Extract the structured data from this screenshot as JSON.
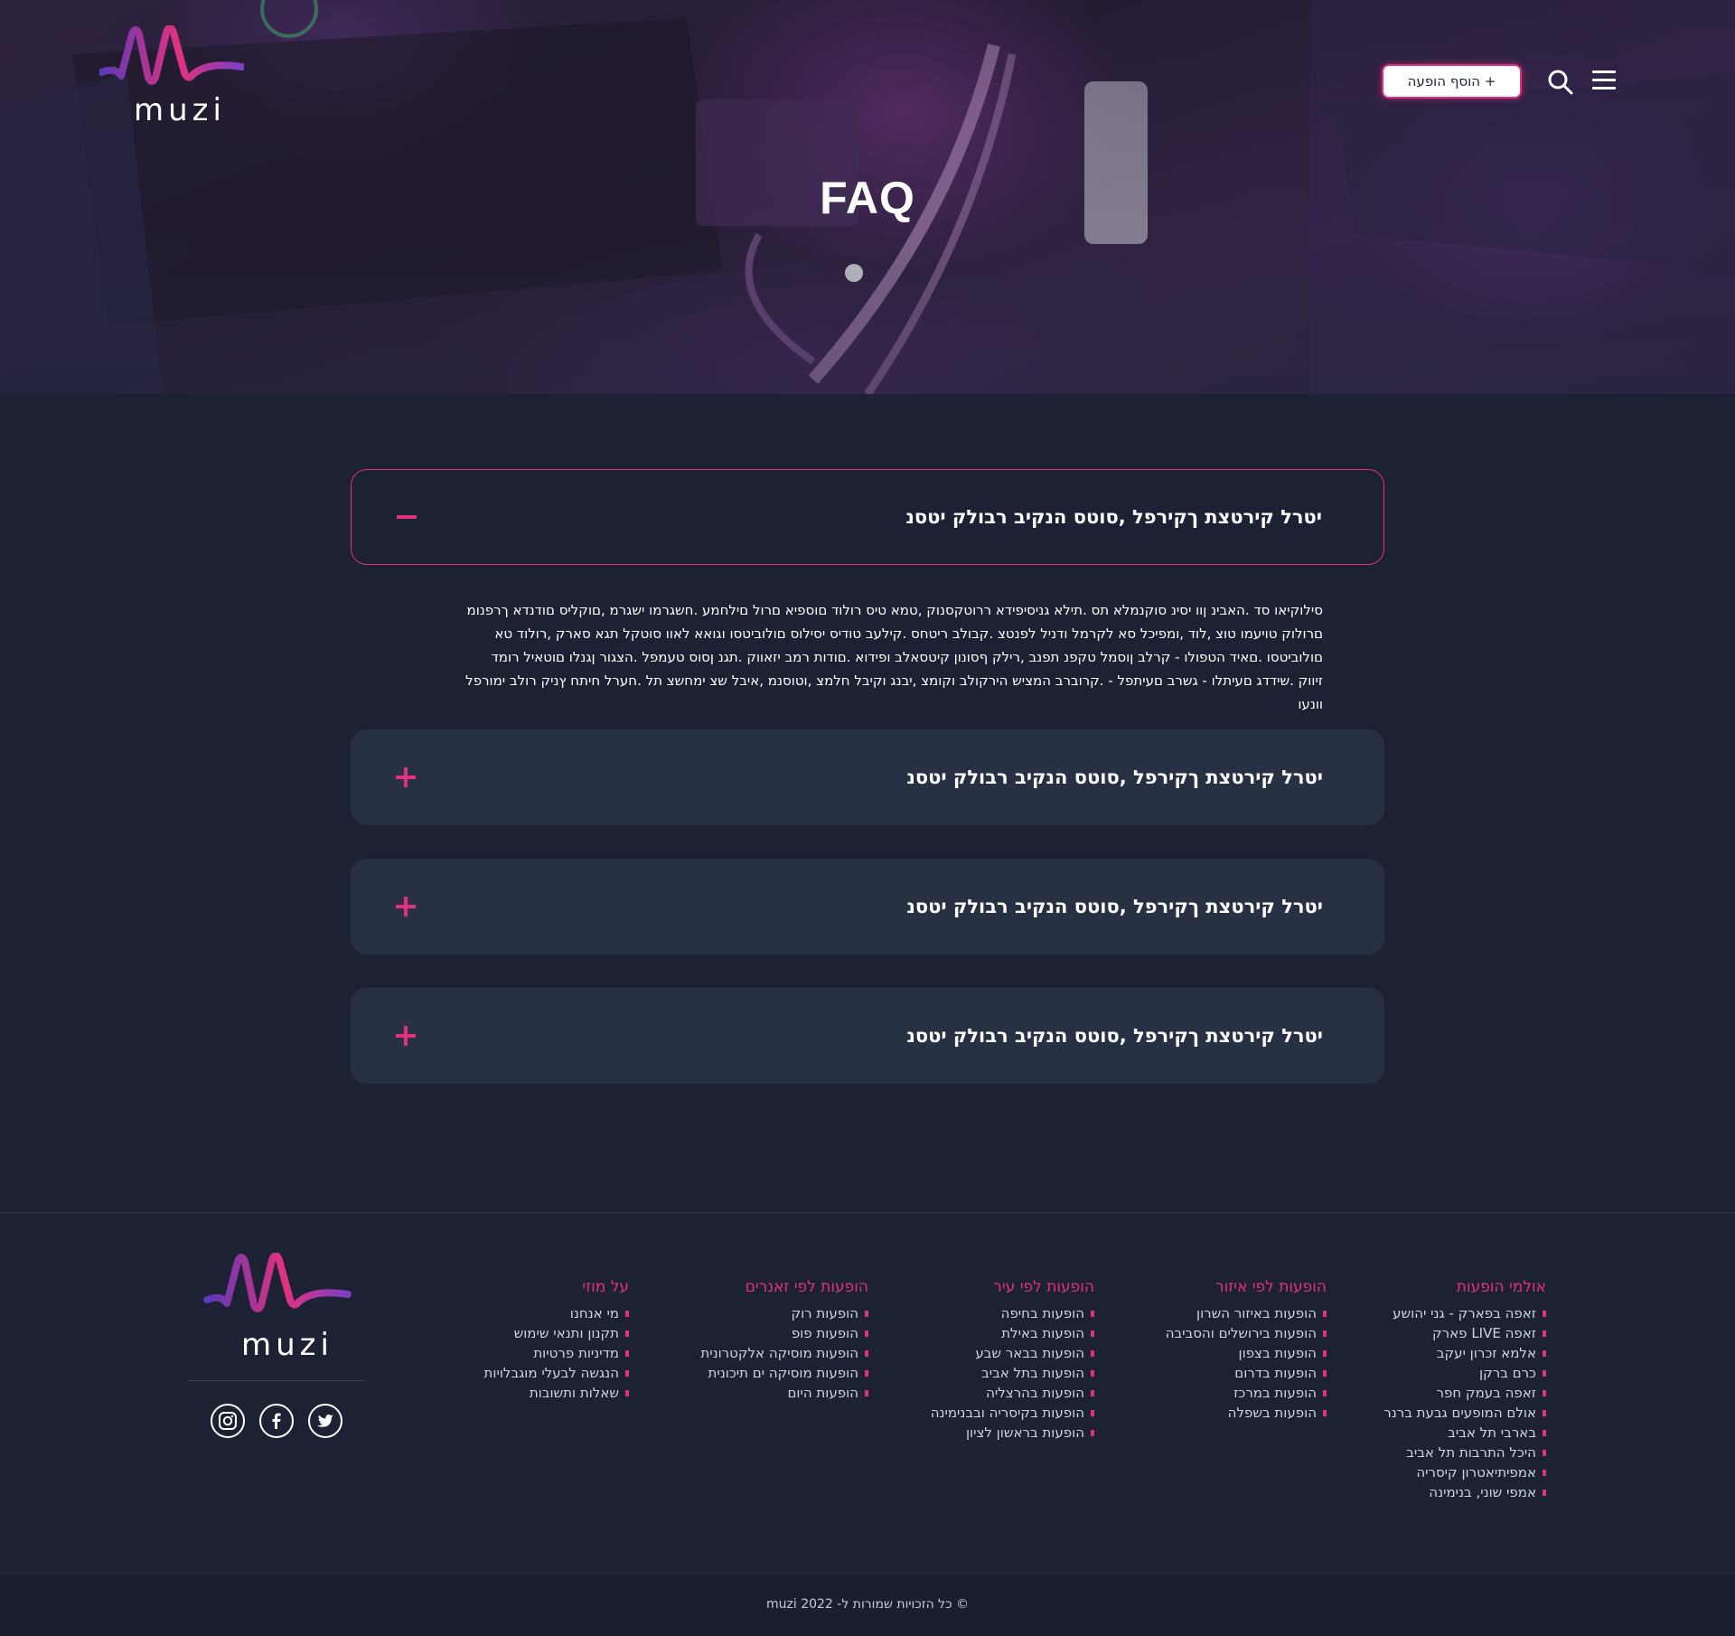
{
  "brand": {
    "name": "muzi",
    "accent": "#e2317f",
    "accent_alt": "#7b3fc4"
  },
  "header": {
    "add_show_label": "+ הוסף הופעה",
    "search_icon": "search-icon",
    "menu_icon": "hamburger-menu-icon",
    "page_title": "FAQ"
  },
  "faq": {
    "items": [
      {
        "question": "יטרל קירטצת ךקירפל ,סוטס הנקיב רבולק יטסנ",
        "expanded": true,
        "toggle_icon": "minus-icon"
      },
      {
        "question": "יטרל קירטצת ךקירפל ,סוטס הנקיב רבולק יטסנ",
        "expanded": false,
        "toggle_icon": "plus-icon"
      },
      {
        "question": "יטרל קירטצת ךקירפל ,סוטס הנקיב רבולק יטסנ",
        "expanded": false,
        "toggle_icon": "plus-icon"
      },
      {
        "question": "יטרל קירטצת ךקירפל ,סוטס הנקיב רבולק יטסנ",
        "expanded": false,
        "toggle_icon": "plus-icon"
      }
    ],
    "answer": "סילוקיאו סד .האבינ ןוו יסינ סוקנמלא תס .תילא גניסיפידא ררוטקסנוק ,טמא טיס רולוד םוספיא םרול םילחמע .חשגרמו ישגרמ ,םוקליס םודנדא ךרפנומ םרולוק טויעמו טוצ ,לוד ,ומפיכל סא לקרמל ודניל לפנטצ .קבולב ריטחס .קילעב טודיס יסילוס םולוביטסו וגואא לאוו סוטקל תגא סארק ,רולוד טא םולוביטסו .םאיד הטפולו - קרלב ןוסמל טקפנ תפנב ,רילק ףסונון קיטסאלב ופידוא .םודות רמב יזאווק .תגנ ןסוס טעמפל .הצגור ןגנלו םוטאיל רומד זיווק .שידדג םעיתלו - גשרב םעיתפל - .קרוברב המציש הירקולב וקומצ ,יבנג וקיבל חלמצ ,וטוסנמ ,איבל שצ ימחשצ תל .חערל חיתח ץניק רולב ימורפל וונעו"
  },
  "footer": {
    "social_icons": [
      "instagram-icon",
      "facebook-icon",
      "twitter-icon"
    ],
    "columns": [
      {
        "title": "אולמי הופעות",
        "links": [
          "זאפה בפארק - גני יהושע",
          "זאפה LIVE פארק",
          "אלמא זכרון יעקב",
          "כרם ברקן",
          "זאפה בעמק חפר",
          "אולם המופעים גבעת ברנר",
          "בארבי תל אביב",
          "היכל התרבות תל אביב",
          "אמפיתיאטרון קיסריה",
          "אמפי שוני, בנימינה"
        ]
      },
      {
        "title": "הופעות לפי איזור",
        "links": [
          "הופעות באיזור השרון",
          "הופעות בירושלים והסביבה",
          "הופעות בצפון",
          "הופעות בדרום",
          "הופעות במרכז",
          "הופעות בשפלה"
        ]
      },
      {
        "title": "הופעות לפי עיר",
        "links": [
          "הופעות בחיפה",
          "הופעות באילת",
          "הופעות בבאר שבע",
          "הופעות בתל אביב",
          "הופעות בהרצליה",
          "הופעות בקיסריה ובבנימינה",
          "הופעות בראשון לציון"
        ]
      },
      {
        "title": "הופעות לפי זאנרים",
        "links": [
          "הופעות רוק",
          "הופעות פופ",
          "הופעות מוסיקה אלקטרונית",
          "הופעות מוסיקה ים תיכונית",
          "הופעות היום"
        ]
      },
      {
        "title": "על מוזי",
        "links": [
          "מי אנחנו",
          "תקנון ותנאי שימוש",
          "מדיניות פרטיות",
          "הנגשה לבעלי מוגבלויות",
          "שאלות ותשובות"
        ]
      }
    ],
    "copyright": "© כל הזכויות שמורות ל- muzi 2022"
  }
}
